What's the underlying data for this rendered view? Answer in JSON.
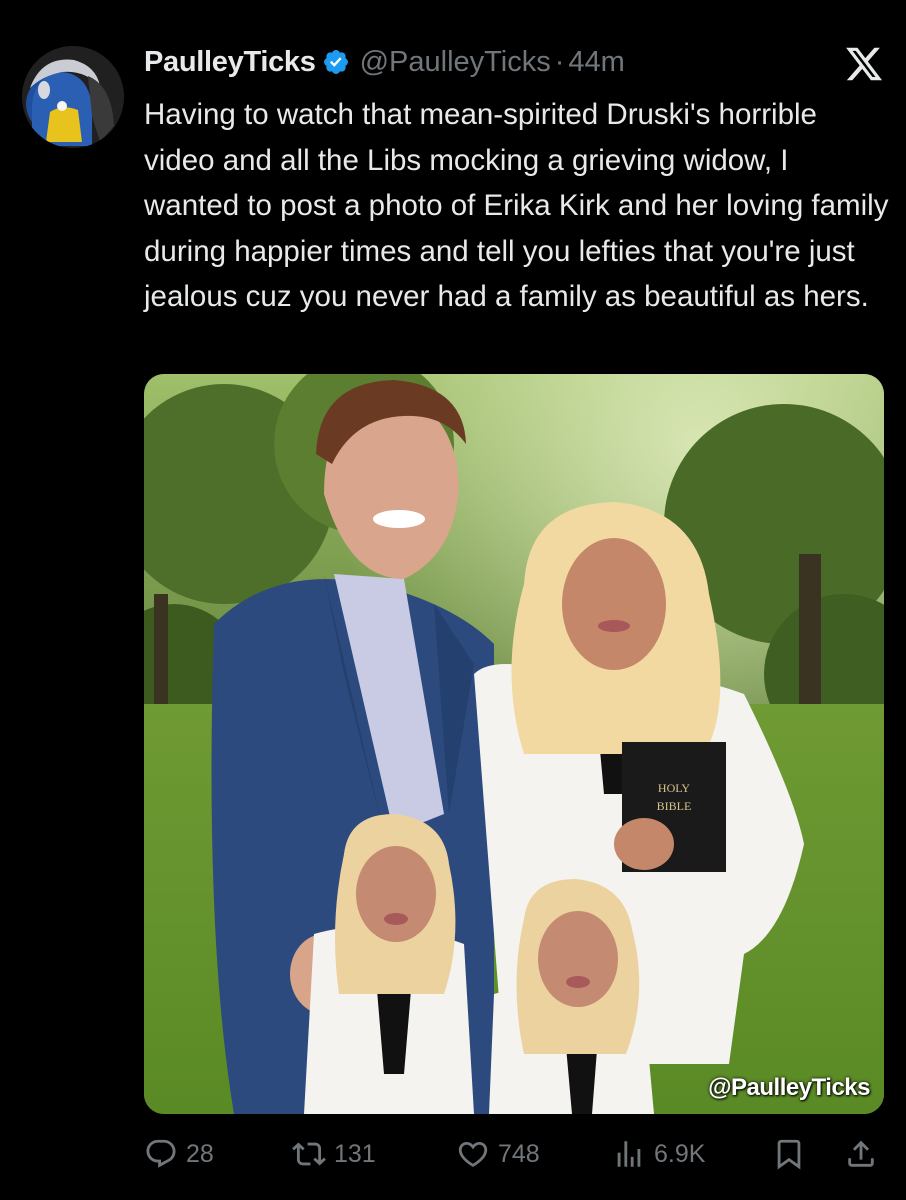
{
  "tweet": {
    "display_name": "PaulleyTicks",
    "handle": "@PaulleyTicks",
    "separator": "·",
    "time": "44m",
    "text": "Having to watch that mean-spirited Druski's horrible video and all the Libs mocking a grieving widow, I wanted to post a photo of Erika Kirk and her loving family during happier times and tell you lefties that you're just jealous cuz you never had a family as beautiful as hers.",
    "media": {
      "watermark": "@PaulleyTicks",
      "bible_text_line1": "HOLY",
      "bible_text_line2": "BIBLE"
    }
  },
  "actions": {
    "replies": "28",
    "reposts": "131",
    "likes": "748",
    "views": "6.9K"
  },
  "icons": {
    "verified": "verified-badge-icon",
    "platform": "x-logo-icon",
    "reply": "reply-icon",
    "repost": "repost-icon",
    "like": "heart-icon",
    "views": "views-icon",
    "bookmark": "bookmark-icon",
    "share": "share-icon"
  },
  "colors": {
    "background": "#000000",
    "text": "#e7e9ea",
    "secondary": "#71767b",
    "verified": "#1d9bf0"
  }
}
